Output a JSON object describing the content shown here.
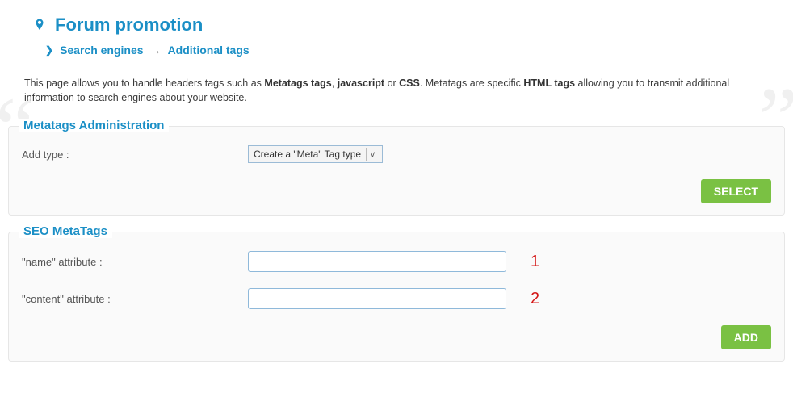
{
  "header": {
    "title": "Forum promotion",
    "crumb1": "Search engines",
    "crumb2": "Additional tags"
  },
  "intro": {
    "part1": "This page allows you to handle headers tags such as ",
    "b1": "Metatags tags",
    "sep1": ", ",
    "b2": "javascript",
    "sep2": " or ",
    "b3": "CSS",
    "part2": ". Metatags are specific ",
    "b4": "HTML tags",
    "part3": " allowing you to transmit additional information to search engines about your website."
  },
  "section1": {
    "title": "Metatags Administration",
    "add_type_label": "Add type :",
    "select_value": "Create a \"Meta\" Tag type",
    "select_button": "SELECT"
  },
  "section2": {
    "title": "SEO MetaTags",
    "name_label": "\"name\" attribute :",
    "name_value": "",
    "content_label": "\"content\" attribute :",
    "content_value": "",
    "add_button": "ADD",
    "annot1": "1",
    "annot2": "2"
  }
}
